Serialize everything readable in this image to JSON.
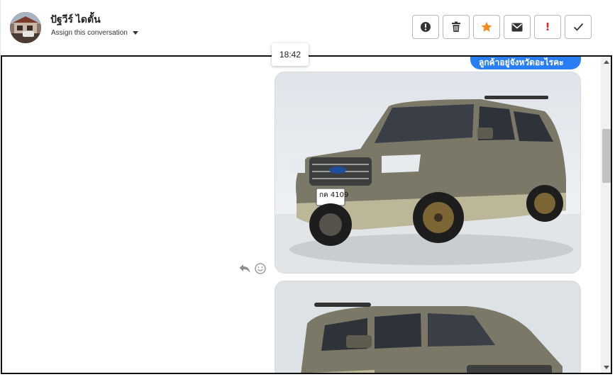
{
  "contact": {
    "name": "ปัฐวีร์ ไดตั้น",
    "assign_label": "Assign this conversation"
  },
  "toolbar": {
    "buttons": [
      {
        "name": "important-button",
        "icon": "alert-circle-icon"
      },
      {
        "name": "delete-button",
        "icon": "trash-icon"
      },
      {
        "name": "star-button",
        "icon": "star-icon",
        "color": "#f08c1f"
      },
      {
        "name": "email-button",
        "icon": "envelope-icon"
      },
      {
        "name": "priority-button",
        "icon": "exclamation-icon",
        "color": "#e3262b"
      },
      {
        "name": "done-button",
        "icon": "check-icon"
      }
    ],
    "exclaim_label": "!"
  },
  "conversation": {
    "timestamp": "18:42",
    "message_text": "ลูกค้าอยู่จังหวัดอะไรคะ",
    "bubble_color": "#2a7ef3",
    "attachments": [
      {
        "type": "image",
        "subject": "grey SUV",
        "plate": "กค 4109"
      },
      {
        "type": "image",
        "subject": "grey SUV rear"
      }
    ]
  },
  "message_actions": {
    "reply_icon": "reply-icon",
    "emoji_icon": "smile-icon"
  }
}
